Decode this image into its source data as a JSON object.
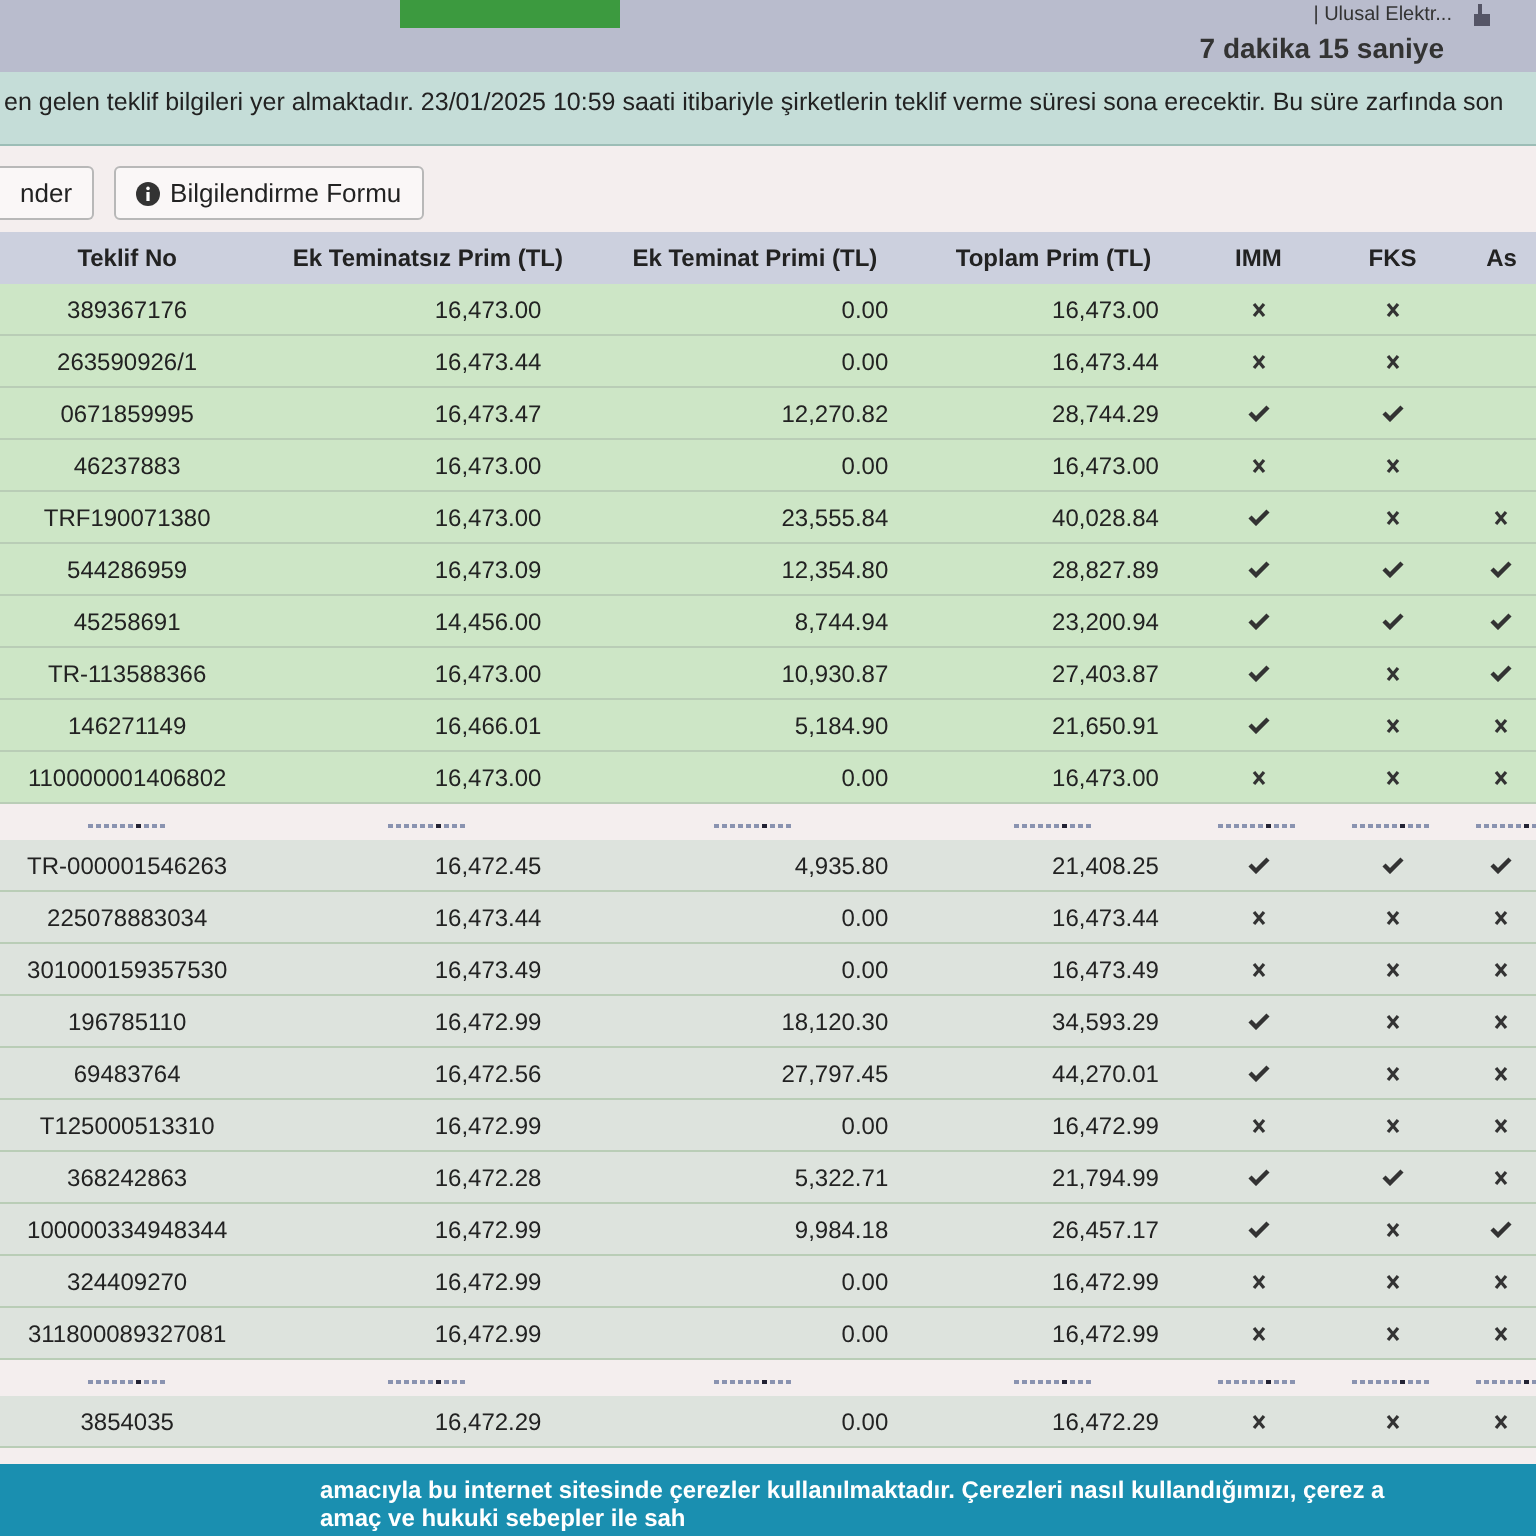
{
  "top_bar": {
    "site_label": "| Ulusal Elektr...",
    "timer": "7 dakika 15 saniye"
  },
  "alert": {
    "text": "en gelen teklif bilgileri yer almaktadır. 23/01/2025 10:59 saati itibariyle şirketlerin teklif verme süresi sona erecektir. Bu süre zarfında son"
  },
  "buttons": [
    {
      "label": "nder",
      "kind": "plain"
    },
    {
      "label": "Bilgilendirme Formu",
      "kind": "info"
    }
  ],
  "table": {
    "columns": [
      "Teklif No",
      "Ek Teminatsız Prim (TL)",
      "Ek Teminat Primi (TL)",
      "Toplam Prim (TL)",
      "IMM",
      "FKS",
      "As"
    ],
    "groups": [
      {
        "highlighted": true,
        "rows": [
          {
            "teklif_no": "389367176",
            "ek_teminatsiz": "16,473.00",
            "ek_teminat": "0.00",
            "toplam": "16,473.00",
            "imm": false,
            "fks": false
          },
          {
            "teklif_no": "263590926/1",
            "ek_teminatsiz": "16,473.44",
            "ek_teminat": "0.00",
            "toplam": "16,473.44",
            "imm": false,
            "fks": false
          },
          {
            "teklif_no": "0671859995",
            "ek_teminatsiz": "16,473.47",
            "ek_teminat": "12,270.82",
            "toplam": "28,744.29",
            "imm": true,
            "fks": true
          },
          {
            "teklif_no": "46237883",
            "ek_teminatsiz": "16,473.00",
            "ek_teminat": "0.00",
            "toplam": "16,473.00",
            "imm": false,
            "fks": false
          },
          {
            "teklif_no": "TRF190071380",
            "ek_teminatsiz": "16,473.00",
            "ek_teminat": "23,555.84",
            "toplam": "40,028.84",
            "imm": true,
            "fks": false,
            "as": false
          },
          {
            "teklif_no": "544286959",
            "ek_teminatsiz": "16,473.09",
            "ek_teminat": "12,354.80",
            "toplam": "28,827.89",
            "imm": true,
            "fks": true,
            "as": true
          },
          {
            "teklif_no": "45258691",
            "ek_teminatsiz": "14,456.00",
            "ek_teminat": "8,744.94",
            "toplam": "23,200.94",
            "imm": true,
            "fks": true,
            "as": true
          },
          {
            "teklif_no": "TR-113588366",
            "ek_teminatsiz": "16,473.00",
            "ek_teminat": "10,930.87",
            "toplam": "27,403.87",
            "imm": true,
            "fks": false,
            "as": true
          },
          {
            "teklif_no": "146271149",
            "ek_teminatsiz": "16,466.01",
            "ek_teminat": "5,184.90",
            "toplam": "21,650.91",
            "imm": true,
            "fks": false,
            "as": false
          },
          {
            "teklif_no": "110000001406802",
            "ek_teminatsiz": "16,473.00",
            "ek_teminat": "0.00",
            "toplam": "16,473.00",
            "imm": false,
            "fks": false,
            "as": false
          }
        ]
      },
      {
        "highlighted": false,
        "rows": [
          {
            "teklif_no": "TR-000001546263",
            "ek_teminatsiz": "16,472.45",
            "ek_teminat": "4,935.80",
            "toplam": "21,408.25",
            "imm": true,
            "fks": true,
            "as": true
          },
          {
            "teklif_no": "225078883034",
            "ek_teminatsiz": "16,473.44",
            "ek_teminat": "0.00",
            "toplam": "16,473.44",
            "imm": false,
            "fks": false,
            "as": false
          },
          {
            "teklif_no": "301000159357530",
            "ek_teminatsiz": "16,473.49",
            "ek_teminat": "0.00",
            "toplam": "16,473.49",
            "imm": false,
            "fks": false,
            "as": false
          },
          {
            "teklif_no": "196785110",
            "ek_teminatsiz": "16,472.99",
            "ek_teminat": "18,120.30",
            "toplam": "34,593.29",
            "imm": true,
            "fks": false,
            "as": false
          },
          {
            "teklif_no": "69483764",
            "ek_teminatsiz": "16,472.56",
            "ek_teminat": "27,797.45",
            "toplam": "44,270.01",
            "imm": true,
            "fks": false,
            "as": false
          },
          {
            "teklif_no": "T125000513310",
            "ek_teminatsiz": "16,472.99",
            "ek_teminat": "0.00",
            "toplam": "16,472.99",
            "imm": false,
            "fks": false,
            "as": false
          },
          {
            "teklif_no": "368242863",
            "ek_teminatsiz": "16,472.28",
            "ek_teminat": "5,322.71",
            "toplam": "21,794.99",
            "imm": true,
            "fks": true,
            "as": false
          },
          {
            "teklif_no": "100000334948344",
            "ek_teminatsiz": "16,472.99",
            "ek_teminat": "9,984.18",
            "toplam": "26,457.17",
            "imm": true,
            "fks": false,
            "as": true
          },
          {
            "teklif_no": "324409270",
            "ek_teminatsiz": "16,472.99",
            "ek_teminat": "0.00",
            "toplam": "16,472.99",
            "imm": false,
            "fks": false,
            "as": false
          },
          {
            "teklif_no": "311800089327081",
            "ek_teminatsiz": "16,472.99",
            "ek_teminat": "0.00",
            "toplam": "16,472.99",
            "imm": false,
            "fks": false,
            "as": false
          }
        ]
      },
      {
        "highlighted": false,
        "rows": [
          {
            "teklif_no": "3854035",
            "ek_teminatsiz": "16,472.29",
            "ek_teminat": "0.00",
            "toplam": "16,472.29",
            "imm": false,
            "fks": false,
            "as": false
          }
        ]
      }
    ]
  },
  "cookie_banner": {
    "lines": [
      "amacıyla bu internet sitesinde çerezler kullanılmaktadır. Çerezleri nasıl kullandığımızı, çerez a",
      "amaç ve hukuki sebepler ile sah"
    ]
  }
}
